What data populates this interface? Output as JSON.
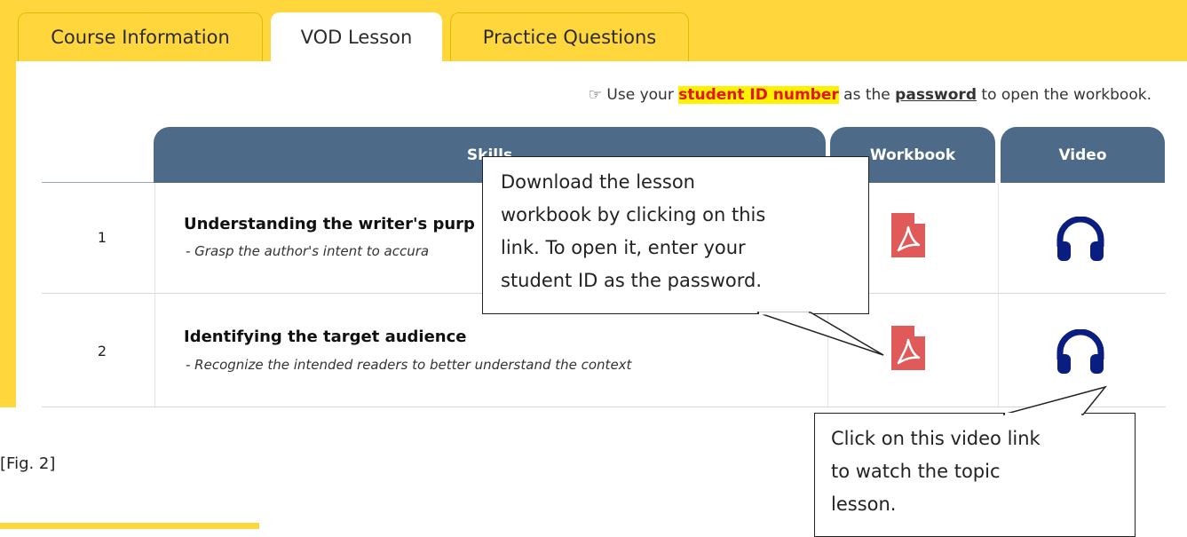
{
  "tabs": [
    {
      "label": "Course Information",
      "active": false
    },
    {
      "label": "VOD Lesson",
      "active": true
    },
    {
      "label": "Practice Questions",
      "active": false
    }
  ],
  "notice": {
    "prefix": " Use your ",
    "highlight": "student ID number",
    "middle": " as the ",
    "underlined": "password",
    "suffix": " to open the workbook."
  },
  "table": {
    "headers": {
      "skills": "Skills",
      "workbook": "Workbook",
      "video": "Video"
    },
    "rows": [
      {
        "num": "1",
        "title": "Understanding the writer's purp",
        "desc": "- Grasp the author's intent to accura"
      },
      {
        "num": "2",
        "title": "Identifying the target audience",
        "desc": "- Recognize the intended readers to better understand the context"
      }
    ]
  },
  "icons": {
    "workbook": "pdf-icon",
    "video": "headphones-icon",
    "hand": "pointing-hand-icon"
  },
  "callouts": {
    "workbook_lines": [
      "Download the lesson",
      "workbook by clicking on this",
      "link. To open it, enter your",
      "student ID as the password."
    ],
    "video_lines": [
      "Click on this video link",
      "to watch the topic",
      "lesson."
    ]
  },
  "figure_label": "[Fig. 2]",
  "colors": {
    "tab_yellow": "#FFD73D",
    "header_blue": "#4D6A88",
    "pdf_red": "#E05A5A",
    "headphones_navy": "#0A1E82",
    "highlight_yellow": "#FFF200",
    "highlight_text": "#E01818"
  }
}
